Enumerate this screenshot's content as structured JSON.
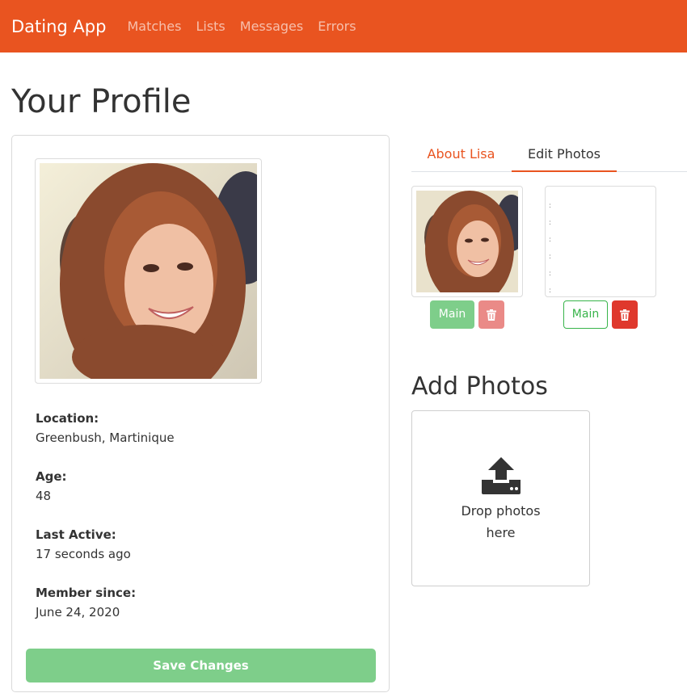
{
  "navbar": {
    "brand": "Dating App",
    "links": [
      "Matches",
      "Lists",
      "Messages",
      "Errors"
    ]
  },
  "page": {
    "title": "Your Profile"
  },
  "profile": {
    "location_label": "Location:",
    "location": "Greenbush, Martinique",
    "age_label": "Age:",
    "age": "48",
    "last_active_label": "Last Active:",
    "last_active": "17 seconds ago",
    "member_since_label": "Member since:",
    "member_since": "June 24, 2020",
    "save_label": "Save Changes"
  },
  "tabs": [
    "About Lisa",
    "Edit Photos"
  ],
  "photos": {
    "main_label": "Main",
    "delete_icon": "trash-icon"
  },
  "upload": {
    "title": "Add Photos",
    "drop_text_line1": "Drop photos",
    "drop_text_line2": "here",
    "icon": "upload-icon"
  },
  "colors": {
    "primary": "#e95420",
    "success": "#38b44a",
    "success_light": "#7ece8a",
    "danger": "#df382c",
    "danger_light": "#ea8a87"
  }
}
